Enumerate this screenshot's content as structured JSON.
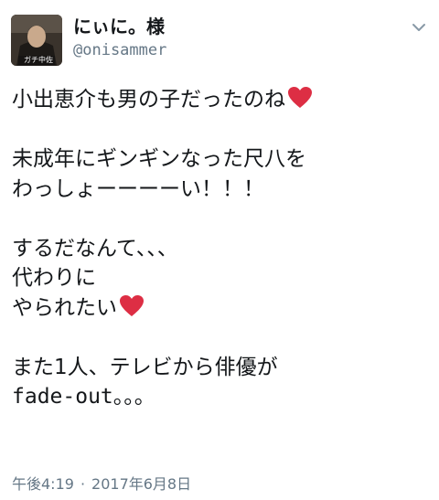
{
  "author": {
    "display_name": "にぃに。様",
    "handle": "@onisammer",
    "avatar_caption": "ガチ中佐"
  },
  "tweet": {
    "lines": [
      {
        "text": "小出恵介も男の子だったのね",
        "heart": true
      },
      {
        "text": "",
        "heart": false
      },
      {
        "text": "未成年にギンギンなった尺八を",
        "heart": false
      },
      {
        "text": "わっしょーーーーい！！！",
        "heart": false
      },
      {
        "text": "",
        "heart": false
      },
      {
        "text": "するだなんて、、、",
        "heart": false
      },
      {
        "text": "代わりに",
        "heart": false
      },
      {
        "text": "やられたい",
        "heart": true
      },
      {
        "text": "",
        "heart": false
      },
      {
        "text": "また1人、テレビから俳優が",
        "heart": false
      },
      {
        "text": "fade-out。。。",
        "heart": false
      }
    ],
    "heart_icon": "red-heart-icon",
    "heart_color": "#dd2e44"
  },
  "meta": {
    "time": "午後4:19",
    "separator": "·",
    "date": "2017年6月8日"
  },
  "menu": {
    "icon": "chevron-down-icon"
  },
  "colors": {
    "text": "#14171a",
    "secondary": "#657786"
  }
}
